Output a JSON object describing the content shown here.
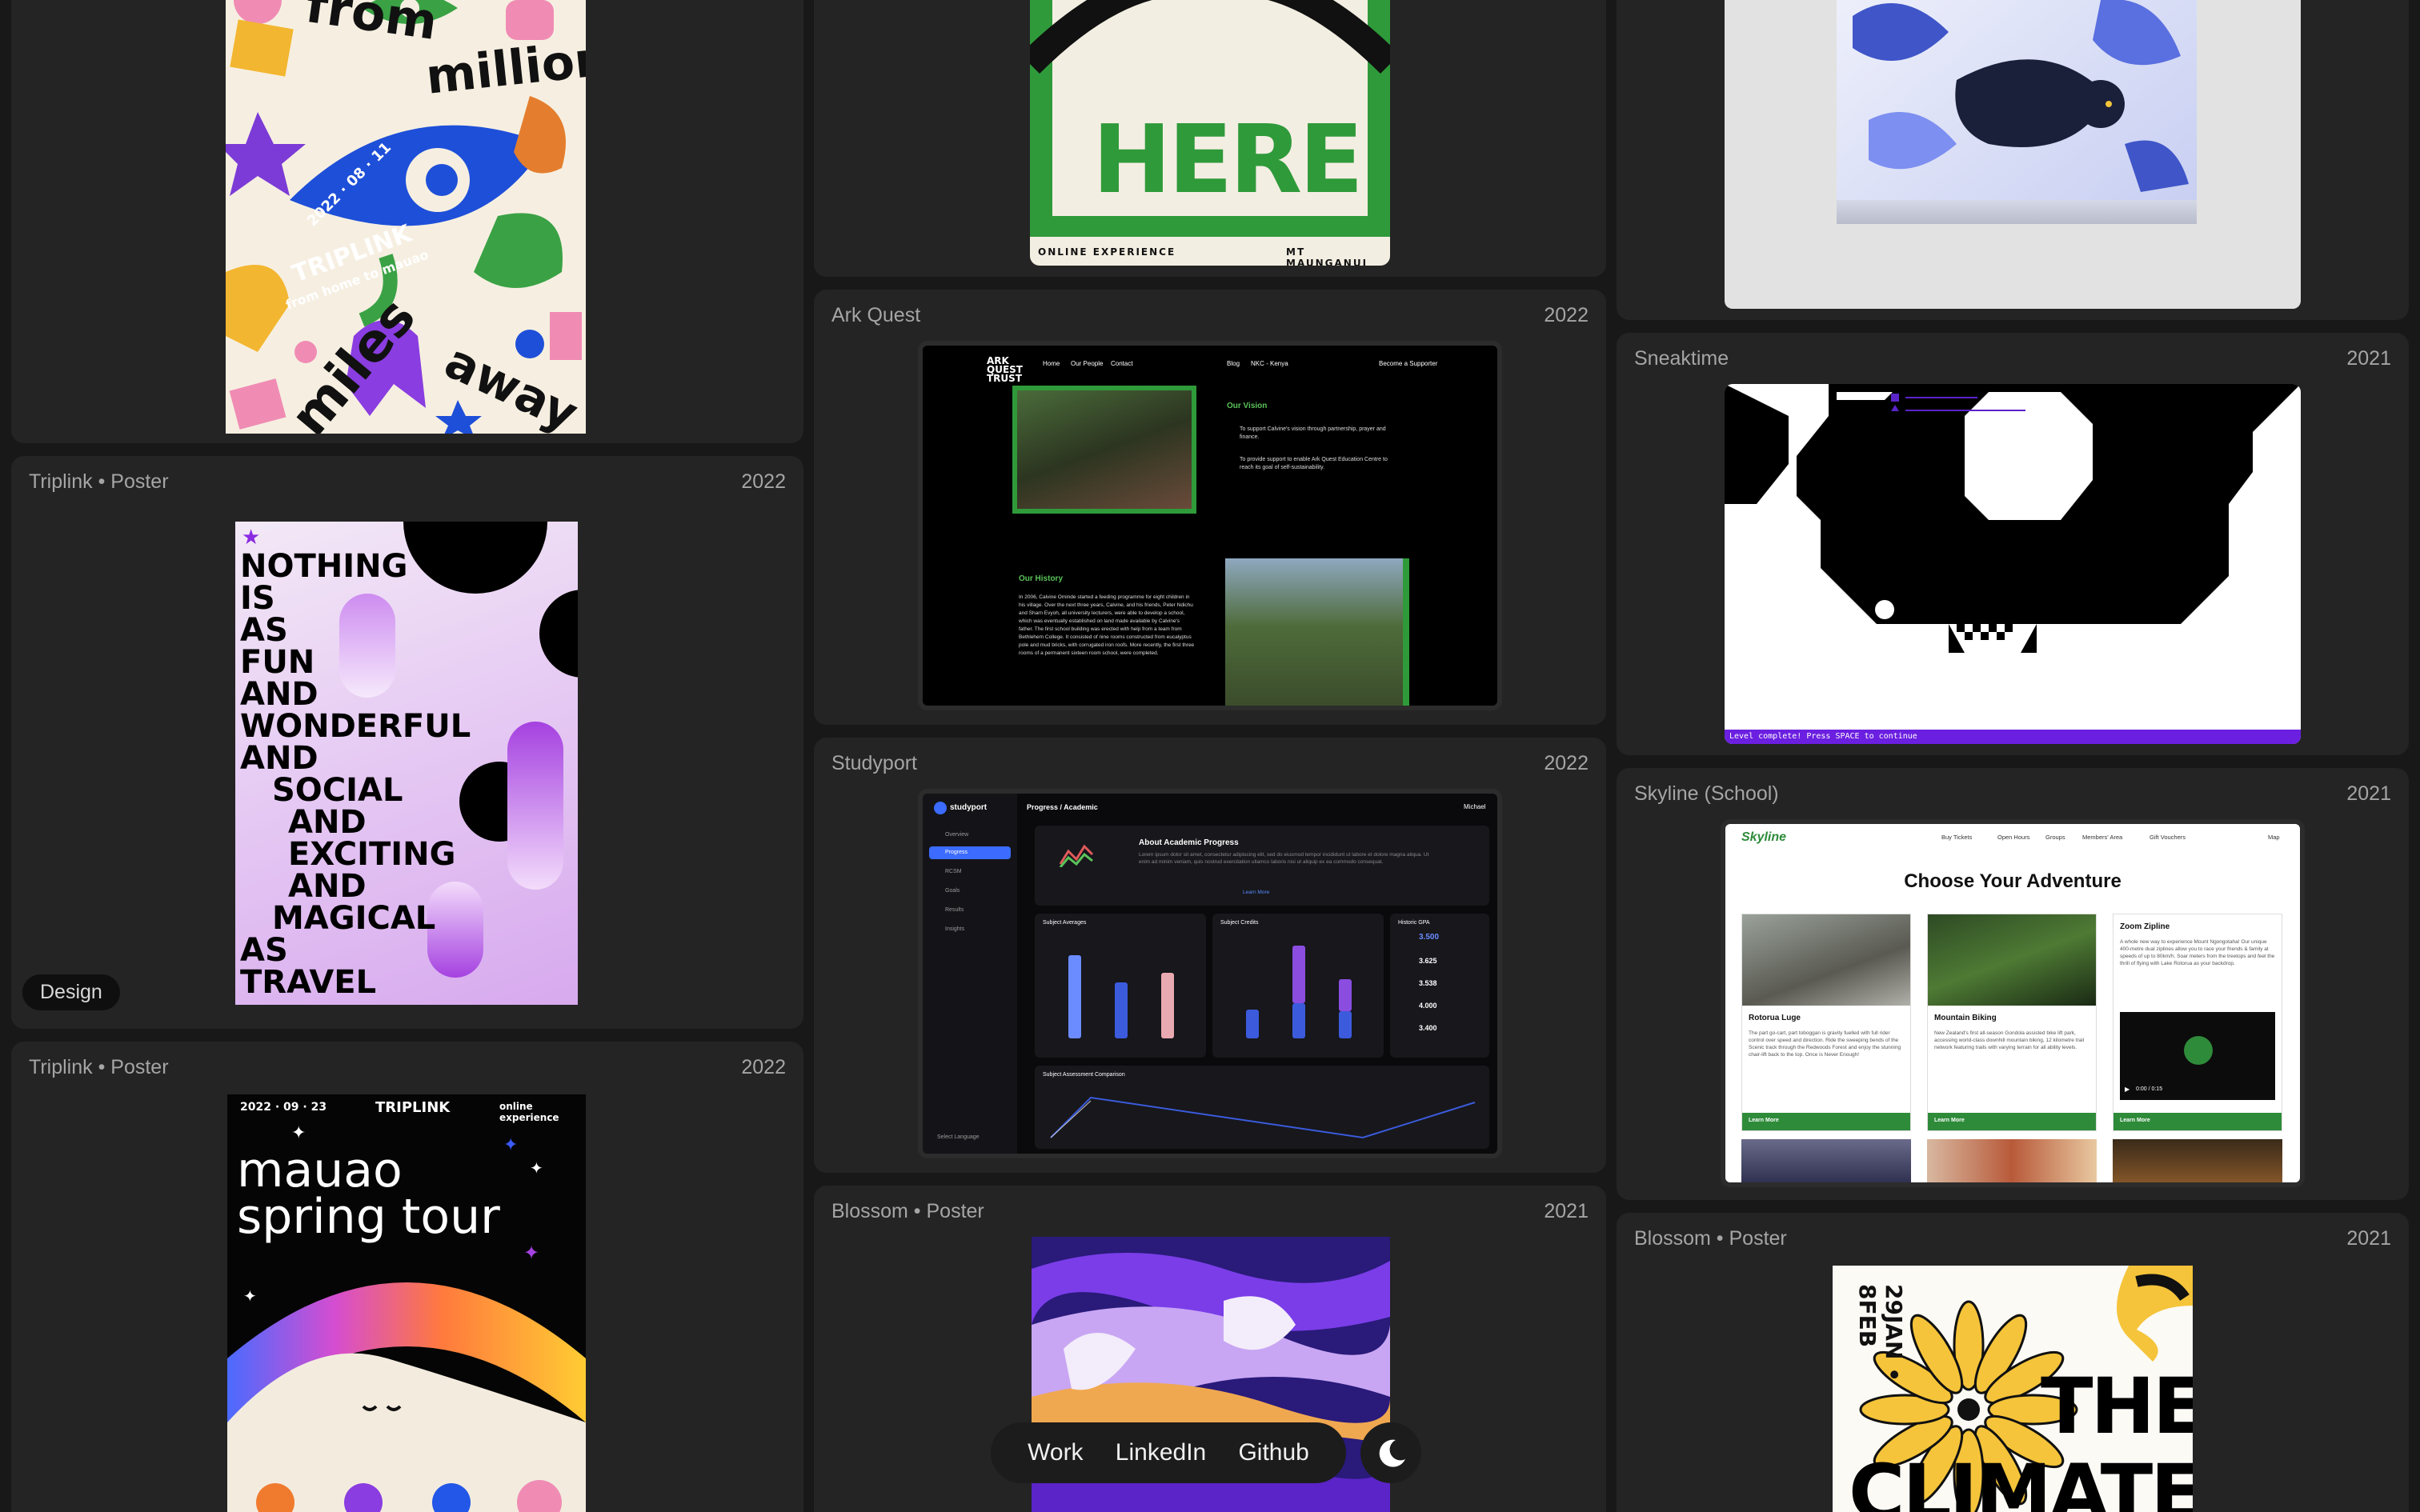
{
  "projects": [
    {
      "title": "Triplink • Poster",
      "year": "2022",
      "tag": "Design"
    },
    {
      "title": "Triplink • Poster",
      "year": "2022"
    },
    {
      "title": "Ark Quest",
      "year": "2022"
    },
    {
      "title": "Studyport",
      "year": "2022"
    },
    {
      "title": "Blossom • Poster",
      "year": "2021"
    },
    {
      "title": "Sneaktime",
      "year": "2021"
    },
    {
      "title": "Skyline (School)",
      "year": "2021"
    },
    {
      "title": "Blossom • Poster",
      "year": "2021"
    }
  ],
  "poster1": {
    "w1": "from",
    "w2": "million",
    "w3": "miles",
    "w4": "away",
    "date": "2022 · 08 · 11",
    "brand": "TRIPLINK",
    "brand_sub": "from home to mauao"
  },
  "poster_here": {
    "big": "HERE",
    "left": "ONLINE EXPERIENCE",
    "right": "MT MAUNGANUI"
  },
  "poster2": {
    "lines": [
      "NOTHING",
      "IS",
      "AS",
      "FUN",
      "AND",
      "WONDERFUL",
      "AND",
      "SOCIAL",
      "AND",
      "EXCITING",
      "AND",
      "MAGICAL",
      "AS",
      "TRAVEL"
    ]
  },
  "poster3": {
    "date": "2022 · 09 · 23",
    "brand": "TRIPLINK",
    "right": "online experience",
    "title1": "mauao",
    "title2": "spring tour"
  },
  "ark": {
    "nav": [
      "Home",
      "Our People",
      "Contact",
      "Blog",
      "NKC - Kenya",
      "Become a Supporter"
    ],
    "logo": "ARK QUEST TRUST",
    "vision_h": "Our Vision",
    "vision1": "To support Calvine's vision through partnership, prayer and finance.",
    "vision2": "To provide support to enable Ark Quest Education Centre to reach its goal of self-sustainability.",
    "history_h": "Our History",
    "history": "In 2006, Calvine Ominde started a feeding programme for eight children in his village. Over the next three years, Calvine, and his friends, Peter Ndichu and Sharn Evyoh, all university lecturers, were able to develop a school, which was eventually established on land made available by Calvine's father. The first school building was erected with help from a team from Bethlehem College. It consisted of nine rooms constructed from eucalyptus pole and mud bricks, with corrugated iron roofs. More recently, the first three rooms of a permanent sixteen room school, were completed."
  },
  "study": {
    "logo": "studyport",
    "crumb": "Progress / Academic",
    "user": "Michael",
    "menu": [
      "Overview",
      "Progress",
      "RCSM",
      "Goals",
      "Results",
      "Insights"
    ],
    "lang": "Select Language",
    "about_h": "About Academic Progress",
    "about_t": "Lorem ipsum dolor sit amet, consectetur adipiscing elit, sed do eiusmod tempor incididunt ut labore et dolore magna aliqua. Ut enim ad minim veniam, quis nostrud exercitation ullamco laboris nisi ut aliquip ex ea commodo consequat.",
    "learn": "Learn More",
    "card1": "Subject Averages",
    "card2": "Subject Credits",
    "card3": "Historic GPA",
    "gpa": [
      "3.500",
      "3.625",
      "3.538",
      "4.000",
      "3.400"
    ],
    "comp": "Subject Assessment Comparison"
  },
  "sneak": {
    "status": "Level complete! Press SPACE to continue"
  },
  "skyline": {
    "logo": "Skyline",
    "nav": [
      "Buy Tickets",
      "Open Hours",
      "Groups",
      "Members' Area",
      "Gift Vouchers",
      "Map"
    ],
    "heading": "Choose Your Adventure",
    "cards": [
      {
        "title": "Rotorua Luge",
        "text": "The part go-cart, part toboggan is gravity fuelled with full rider control over speed and direction. Ride the sweeping bends of the Scenic track through the Redwoods Forest and enjoy the stunning chair-lift back to the top. Once is Never Enough!",
        "btn": "Learn More"
      },
      {
        "title": "Mountain Biking",
        "text": "New Zealand's first all-season Gondola assisted bike lift park, accessing world-class downhill mountain biking, 12 kilometre trail network featuring trails with varying terrain for all ability levels.",
        "btn": "Learn More"
      },
      {
        "title": "Zoom Zipline",
        "text": "A whole new way to experience Mount Ngongotaha! Our unique 400-metre dual ziplines allow you to race your friends & family at speeds of up to 80km/h. Soar meters from the treetops and feel the thrill of flying with Lake Rotorua as your backdrop.",
        "btn": "Learn More",
        "video": "0:00 / 0:15"
      }
    ]
  },
  "climate": {
    "date": "29JAN • 8FEB",
    "t1": "THE",
    "t2": "CLIMATE"
  },
  "nav": {
    "work": "Work",
    "linkedin": "LinkedIn",
    "github": "Github"
  },
  "colors": {
    "page_bg": "#181818",
    "card_bg": "#242424",
    "text": "#a5a5a5"
  }
}
